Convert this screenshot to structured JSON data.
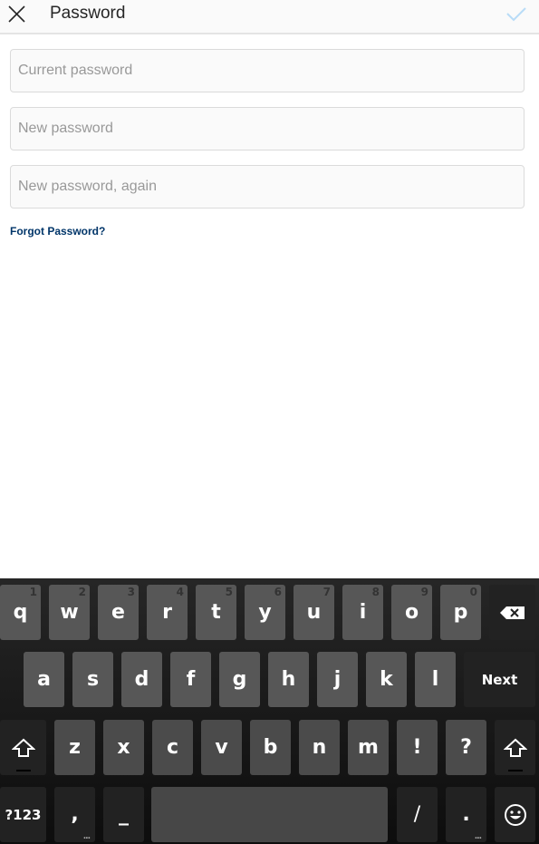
{
  "header": {
    "title": "Password",
    "close_icon": "close-x-icon",
    "confirm_icon": "checkmark-icon",
    "confirm_color": "#b8dcf7"
  },
  "form": {
    "current_password": {
      "value": "",
      "placeholder": "Current password"
    },
    "new_password": {
      "value": "",
      "placeholder": "New password"
    },
    "new_password_again": {
      "value": "",
      "placeholder": "New password, again"
    },
    "forgot_link": "Forgot Password?",
    "link_color": "#003569"
  },
  "keyboard": {
    "row1": [
      {
        "label": "q",
        "hint": "1"
      },
      {
        "label": "w",
        "hint": "2"
      },
      {
        "label": "e",
        "hint": "3"
      },
      {
        "label": "r",
        "hint": "4"
      },
      {
        "label": "t",
        "hint": "5"
      },
      {
        "label": "y",
        "hint": "6"
      },
      {
        "label": "u",
        "hint": "7"
      },
      {
        "label": "i",
        "hint": "8"
      },
      {
        "label": "o",
        "hint": "9"
      },
      {
        "label": "p",
        "hint": "0"
      }
    ],
    "backspace_icon": "backspace-icon",
    "row2": [
      {
        "label": "a"
      },
      {
        "label": "s"
      },
      {
        "label": "d"
      },
      {
        "label": "f"
      },
      {
        "label": "g"
      },
      {
        "label": "h"
      },
      {
        "label": "j"
      },
      {
        "label": "k"
      },
      {
        "label": "l"
      }
    ],
    "next_label": "Next",
    "shift_icon": "shift-icon",
    "row3": [
      {
        "label": "z"
      },
      {
        "label": "x"
      },
      {
        "label": "c"
      },
      {
        "label": "v"
      },
      {
        "label": "b"
      },
      {
        "label": "n"
      },
      {
        "label": "m"
      },
      {
        "label": "!"
      },
      {
        "label": "?"
      }
    ],
    "symbols_label": "?123",
    "comma_label": ",",
    "comma_more": "...",
    "underscore_label": "_",
    "slash_label": "/",
    "period_label": ".",
    "period_more": "...",
    "emoji_icon": "emoji-smiley-icon"
  }
}
